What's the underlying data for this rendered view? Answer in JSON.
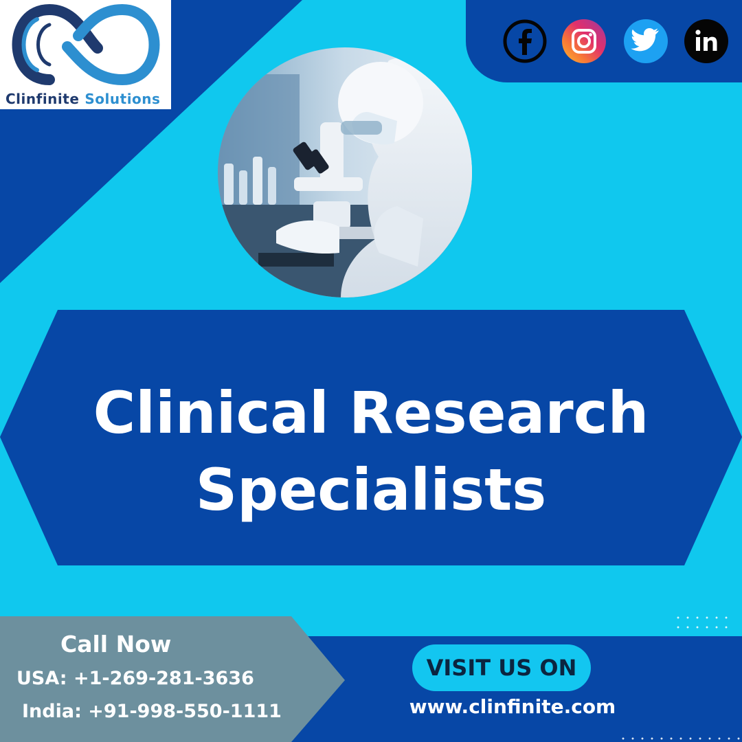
{
  "brand": {
    "name_part1": "Clinfinite",
    "name_part2": "Solutions"
  },
  "social": [
    "facebook-icon",
    "instagram-icon",
    "twitter-icon",
    "linkedin-icon"
  ],
  "headline": {
    "line1": "Clinical Research",
    "line2": "Specialists"
  },
  "contact": {
    "call_label": "Call Now",
    "usa": "USA: +1-269-281-3636",
    "india": "India: +91-998-550-1111"
  },
  "visit": {
    "label": "VISIT US ON",
    "url": "www.clinfinite.com"
  },
  "colors": {
    "background_cyan": "#10c8ee",
    "dark_blue": "#0747a6",
    "slate_gray": "#6d909e"
  }
}
